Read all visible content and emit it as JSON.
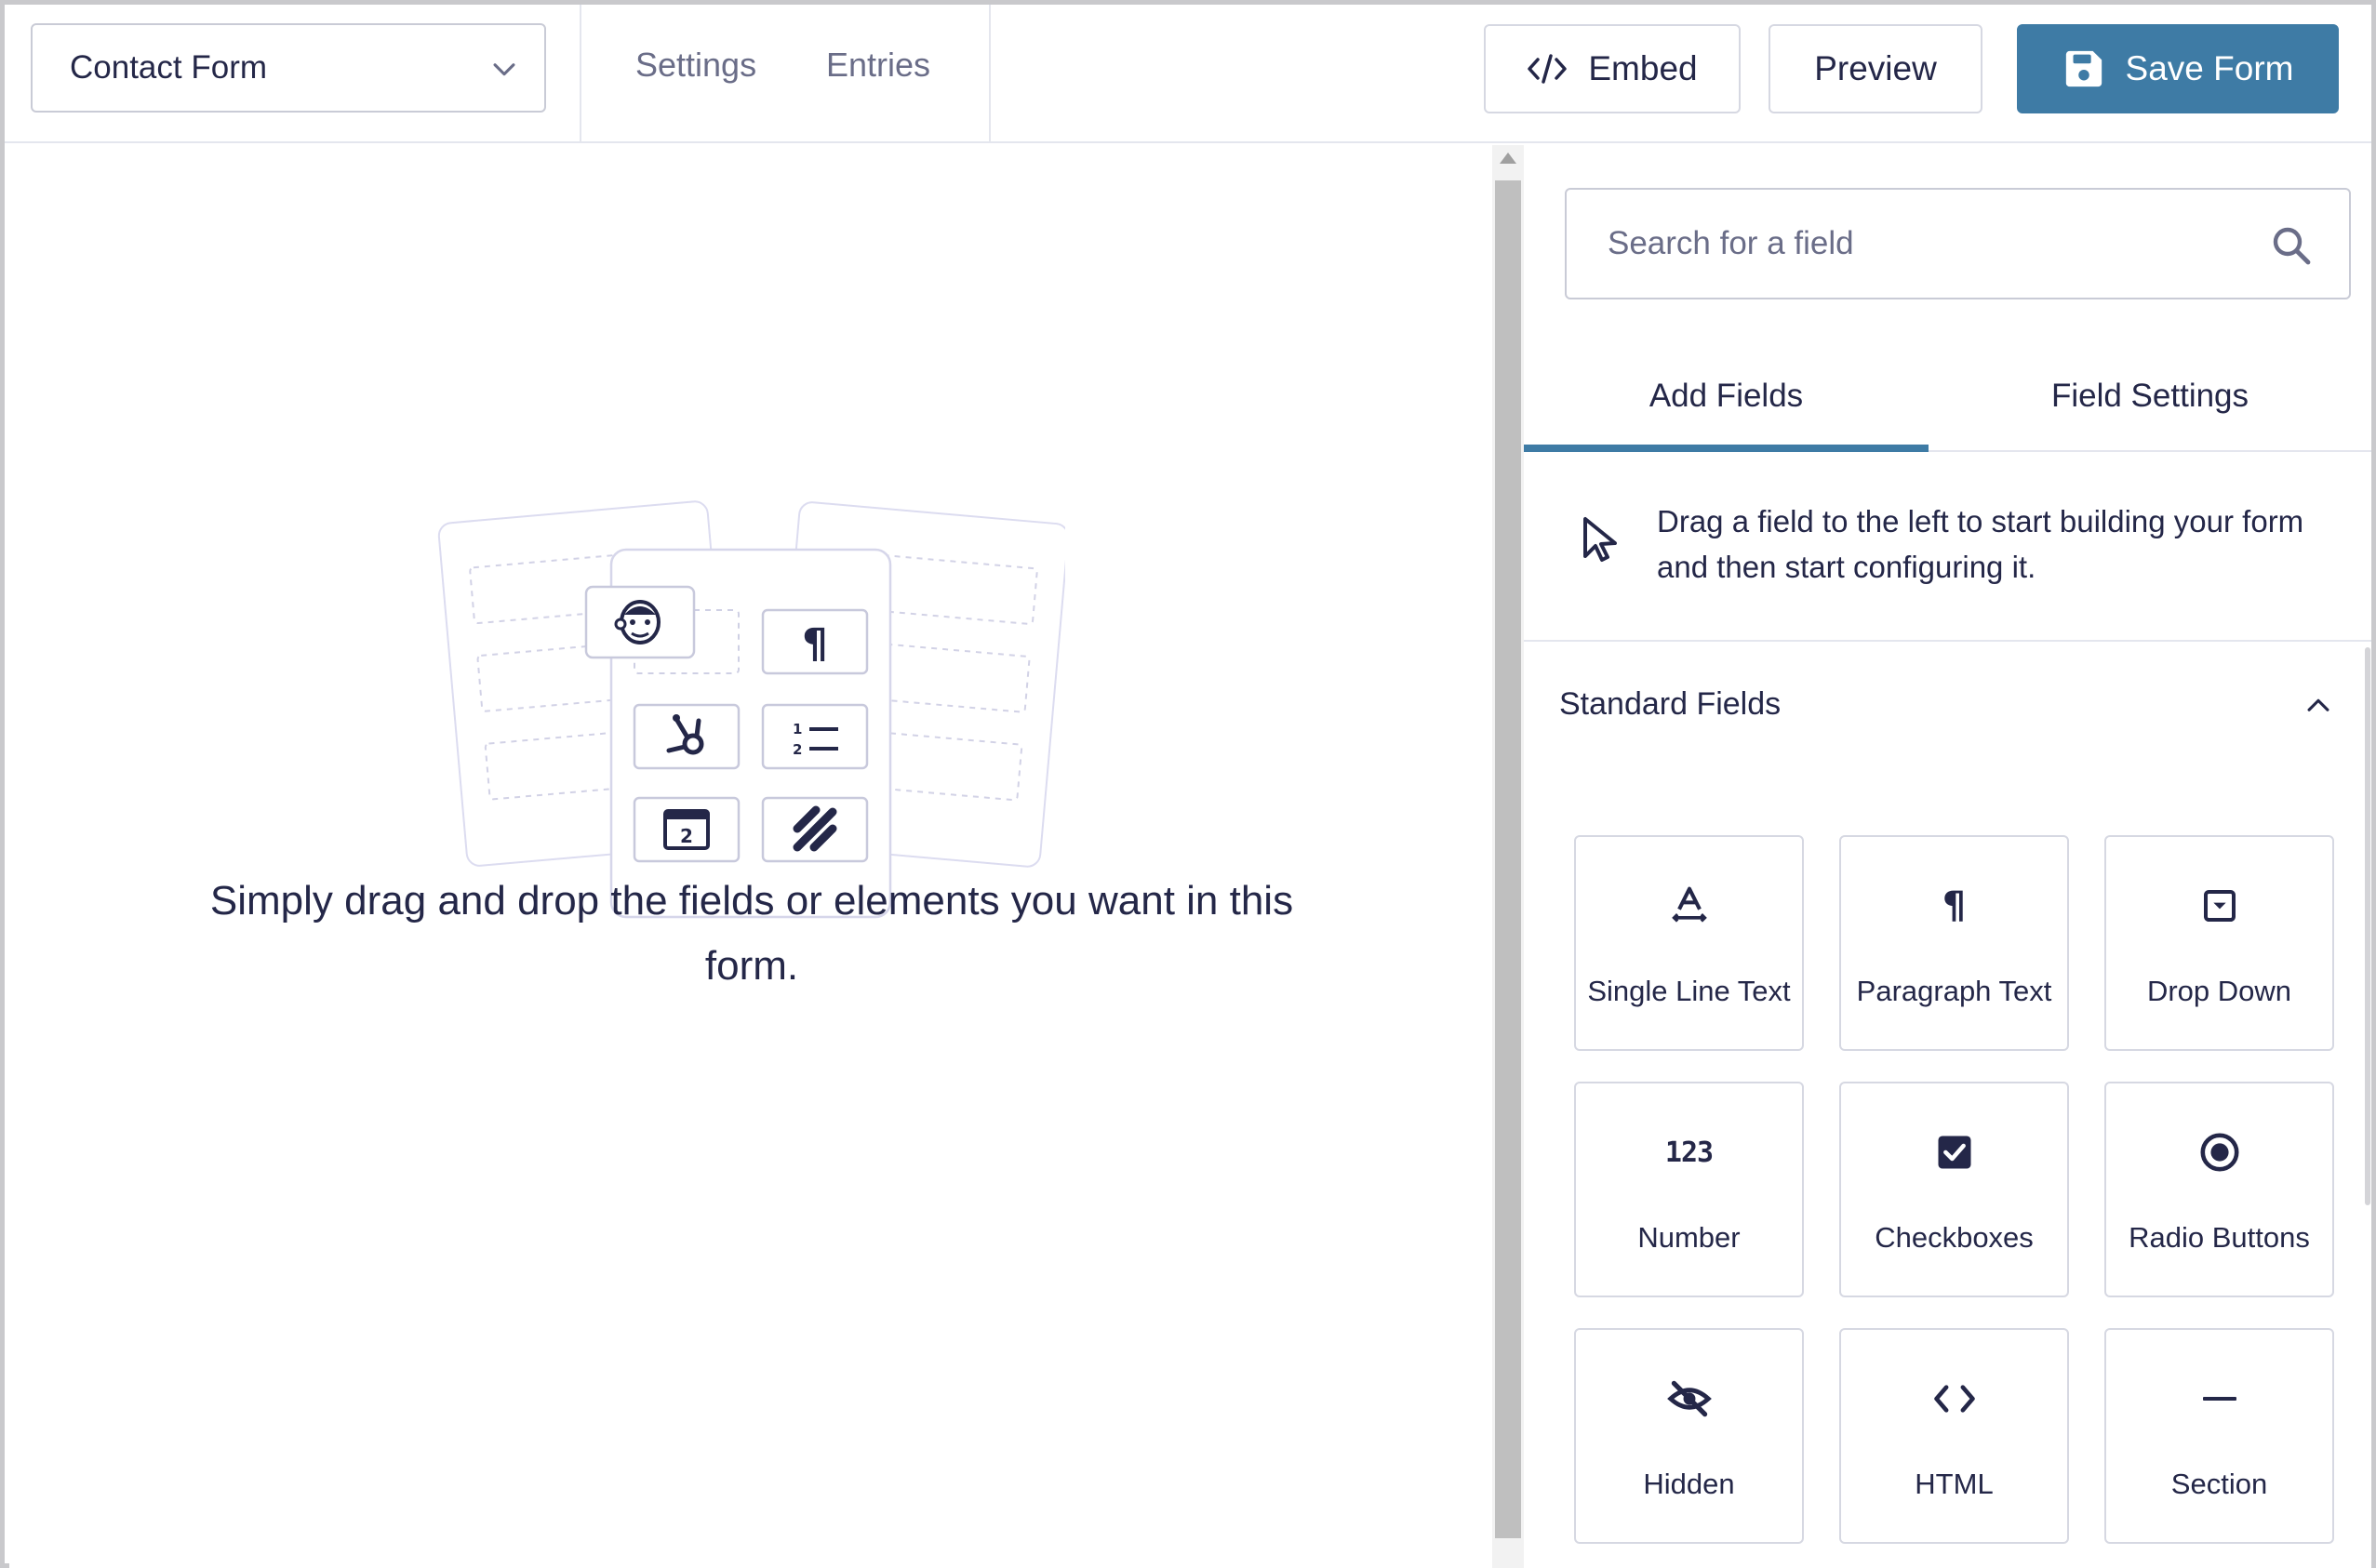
{
  "header": {
    "form_selector_value": "Contact Form",
    "nav": [
      "Settings",
      "Entries"
    ],
    "embed_label": "Embed",
    "preview_label": "Preview",
    "save_label": "Save Form"
  },
  "canvas": {
    "empty_message": "Simply drag and drop the fields or elements you want in this form."
  },
  "sidebar": {
    "search": {
      "placeholder": "Search for a field",
      "value": ""
    },
    "tabs": [
      "Add Fields",
      "Field Settings"
    ],
    "active_tab": "Add Fields",
    "hint": "Drag a field to the left to start building your form and then start configuring it.",
    "section_title": "Standard Fields",
    "fields": [
      {
        "label": "Single Line Text",
        "icon": "single-line-text-icon"
      },
      {
        "label": "Paragraph Text",
        "icon": "paragraph-icon"
      },
      {
        "label": "Drop Down",
        "icon": "dropdown-icon"
      },
      {
        "label": "Number",
        "icon": "number-icon"
      },
      {
        "label": "Checkboxes",
        "icon": "checkbox-icon"
      },
      {
        "label": "Radio Buttons",
        "icon": "radio-icon"
      },
      {
        "label": "Hidden",
        "icon": "hidden-eye-icon"
      },
      {
        "label": "HTML",
        "icon": "code-icon"
      },
      {
        "label": "Section",
        "icon": "section-divider-icon"
      }
    ]
  },
  "colors": {
    "primary": "#3e7ba5",
    "text": "#242748",
    "muted": "#6a6d88",
    "border": "#d6d8e2"
  }
}
